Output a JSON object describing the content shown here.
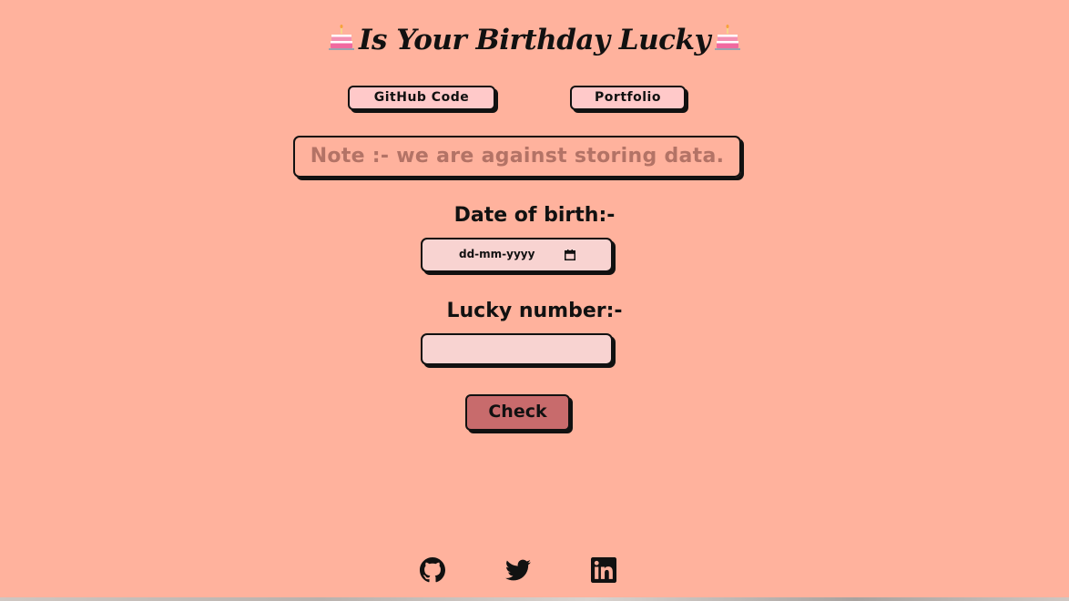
{
  "header": {
    "title": "Is Your Birthday Lucky",
    "left_icon": "birthday-cake-icon",
    "right_icon": "birthday-cake-icon"
  },
  "links": {
    "github_label": "GitHub Code",
    "portfolio_label": "Portfolio"
  },
  "note": {
    "text": "Note :- we are against storing data."
  },
  "form": {
    "dob_label": "Date of birth:-",
    "dob_placeholder": "dd-mm-yyyy",
    "dob_icon": "calendar-icon",
    "lucky_label": "Lucky number:-",
    "lucky_value": "",
    "check_label": "Check"
  },
  "footer": {
    "icons": [
      "github-icon",
      "twitter-icon",
      "linkedin-icon"
    ]
  },
  "colors": {
    "background": "#ffb29d",
    "button": "#ffc9c9",
    "input": "#f8d3d1",
    "check_button": "#c86b6c",
    "note_text": "#b37366"
  }
}
